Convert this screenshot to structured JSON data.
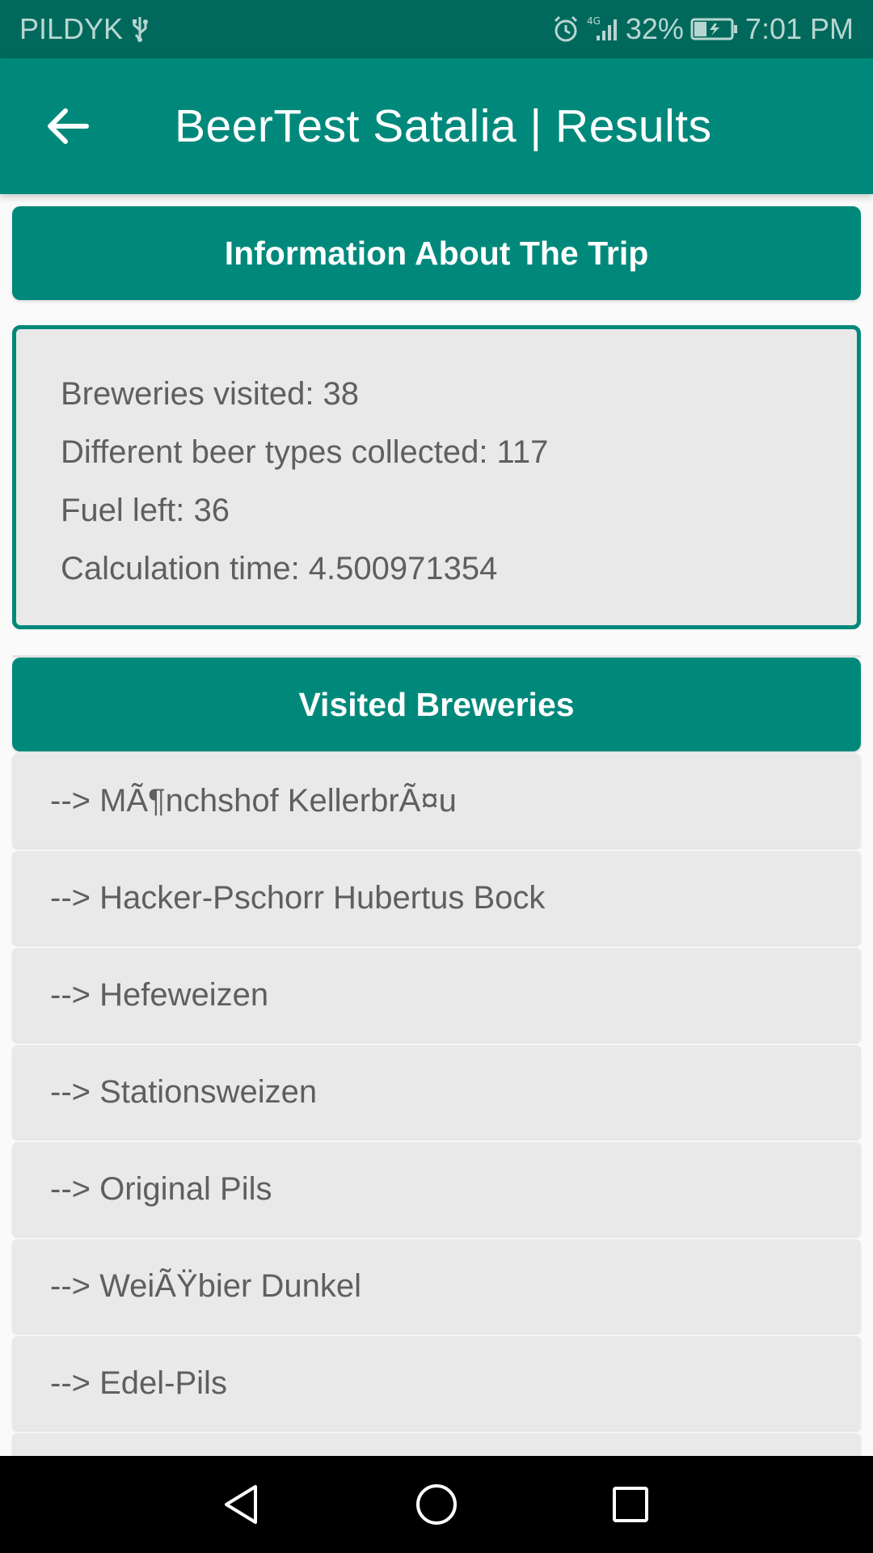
{
  "status_bar": {
    "carrier": "PILDYK",
    "network": "4G",
    "battery": "32%",
    "time": "7:01 PM",
    "color": "#00695c"
  },
  "app_bar": {
    "title": "BeerTest Satalia | Results",
    "color": "#00897b"
  },
  "trip_info": {
    "header": "Information About The Trip",
    "lines": [
      "Breweries visited: 38",
      "Different beer types collected: 117",
      "Fuel left: 36",
      "Calculation time: 4.500971354"
    ]
  },
  "visited": {
    "header": "Visited Breweries",
    "items": [
      "--> MÃ¶nchshof KellerbrÃ¤u",
      "--> Hacker-Pschorr Hubertus Bock",
      "--> Hefeweizen",
      "--> Stationsweizen",
      "--> Original Pils",
      "--> WeiÃŸbier Dunkel",
      "--> Edel-Pils"
    ]
  }
}
